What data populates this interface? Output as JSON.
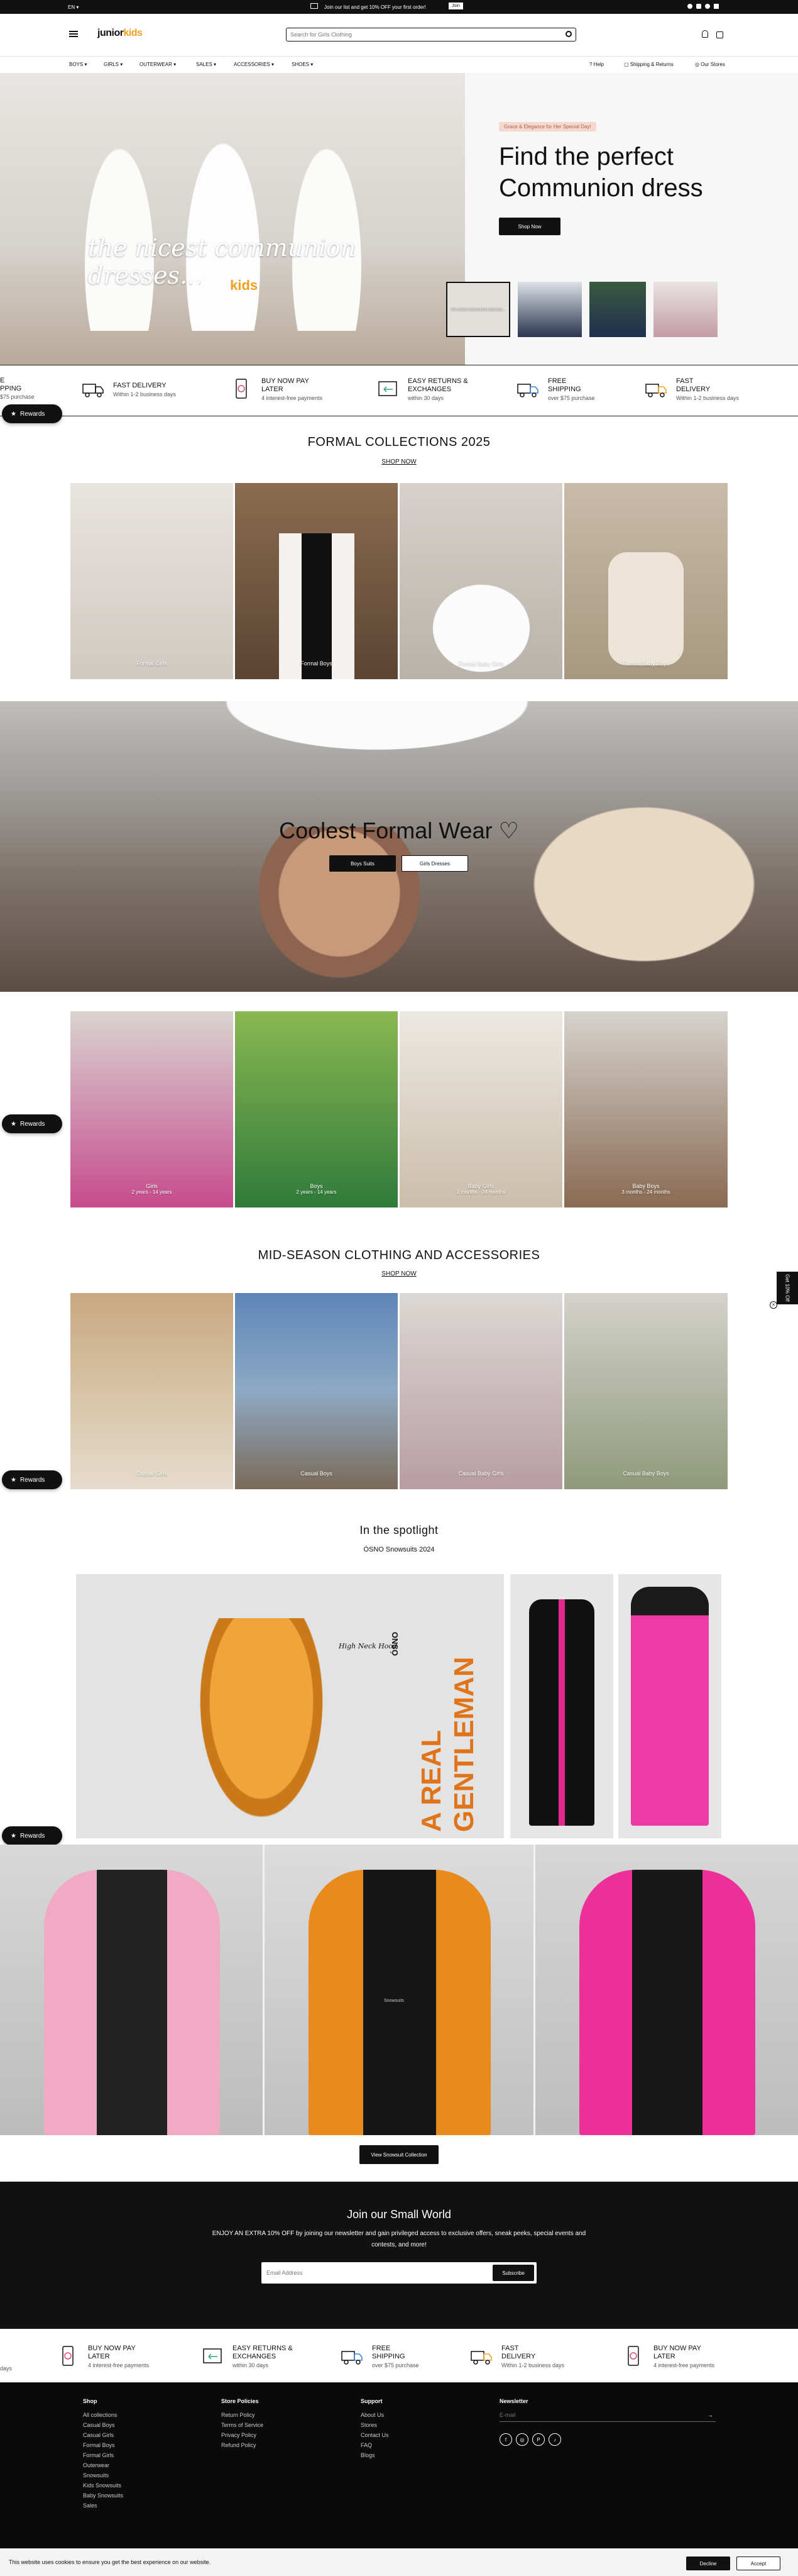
{
  "topbar": {
    "lang": "EN",
    "promo": "Join our list and get 10% OFF your first order!",
    "promo_cta": "Join"
  },
  "header": {
    "logo_a": "junior",
    "logo_b": "kids",
    "search_placeholder": "Search for Girls Clothing"
  },
  "nav": {
    "items": [
      "BOYS",
      "GIRLS",
      "OUTERWEAR",
      "SALES",
      "ACCESSORIES",
      "SHOES"
    ],
    "help": "Help",
    "shipping": "Shipping & Returns",
    "stores": "Our Stores"
  },
  "hero": {
    "script": "the nicest communion dresses...",
    "badge": "Grace & Elegance for Her Special Day!",
    "title_line1": "Find the perfect",
    "title_line2": "Communion dress",
    "cta": "Shop Now",
    "thumb_caption": "the nicest communion dresses..."
  },
  "features": [
    {
      "title": "FAST DELIVERY",
      "sub": "Within 1-2 business days",
      "icon": "truck-icon"
    },
    {
      "title": "BUY NOW PAY LATER",
      "sub": "4 interest-free payments",
      "icon": "phone-payment-icon"
    },
    {
      "title": "EASY RETURNS & EXCHANGES",
      "sub": "within 30 days",
      "icon": "returns-icon"
    },
    {
      "title": "FREE SHIPPING",
      "sub": "over $75 purchase",
      "icon": "shipping-van-icon"
    }
  ],
  "feature_edge": {
    "left_title_1": "E",
    "left_title_2": "PPING",
    "left_sub": "$75 purchase"
  },
  "rewards": {
    "label": "Rewards"
  },
  "formal": {
    "title": "FORMAL COLLECTIONS 2025",
    "link": "SHOP NOW",
    "cards": [
      {
        "label": "Formal Girls",
        "bg": "#d9d4cc"
      },
      {
        "label": "Formal Boys",
        "bg": "#7a6048"
      },
      {
        "label": "Formal Baby Girls",
        "bg": "#c9c2bb"
      },
      {
        "label": "Formal Baby Boys",
        "bg": "#bcae9a"
      }
    ]
  },
  "banner": {
    "title": "Coolest Formal Wear ♡",
    "btn_boys": "Boys Suits",
    "btn_girls": "Girls Dresses"
  },
  "age": {
    "cards": [
      {
        "label": "Girls",
        "sub": "2 years - 14 years",
        "bg": "#c64b8d"
      },
      {
        "label": "Boys",
        "sub": "2 years - 14 years",
        "bg": "#4f8a3d"
      },
      {
        "label": "Baby Girls",
        "sub": "3 months - 24 months",
        "bg": "#d8cfc2"
      },
      {
        "label": "Baby Boys",
        "sub": "3 months - 24 months",
        "bg": "#9a8570"
      }
    ]
  },
  "midseason": {
    "title": "MID-SEASON CLOTHING AND ACCESSORIES",
    "link": "SHOP NOW",
    "cards": [
      {
        "label": "Casual Girls",
        "bg": "#d7c9b3"
      },
      {
        "label": "Casual Boys",
        "bg": "#6f88a8"
      },
      {
        "label": "Casual Baby Girls",
        "bg": "#c9b6b8"
      },
      {
        "label": "Casual Baby Boys",
        "bg": "#a9ab96"
      }
    ]
  },
  "spotlight": {
    "title": "In the spotlight",
    "sub": "ÓSNO Snowsuits 2024",
    "brand": "ÓSNO",
    "vertical": "A REAL GENTLEMAN",
    "handwritten": "High Neck Hood",
    "cta": "View Snowsuit Collection",
    "jacket_text": "Snowsuits"
  },
  "newsletter": {
    "title": "Join our Small World",
    "body": "ENJOY AN EXTRA 10% OFF by joining our newsletter and gain privileged access to exclusive offers, sneak peeks, special events and contests, and more!",
    "placeholder": "Email Address",
    "cta": "Subscribe"
  },
  "features2": [
    {
      "title": "BUY NOW PAY LATER",
      "sub": "4 interest-free payments",
      "icon": "phone-payment-icon"
    },
    {
      "title": "EASY RETURNS & EXCHANGES",
      "sub": "within 30 days",
      "icon": "returns-icon"
    },
    {
      "title": "FREE SHIPPING",
      "sub": "over $75 purchase",
      "icon": "shipping-van-icon"
    },
    {
      "title": "FAST DELIVERY",
      "sub": "Within 1-2 business days",
      "icon": "truck-icon"
    },
    {
      "title": "BUY NOW PAY LATER",
      "sub": "4 interest-free payments",
      "icon": "phone-payment-icon"
    }
  ],
  "features2_edge": "days",
  "footer": {
    "shop": {
      "title": "Shop",
      "items": [
        "All collections",
        "Casual Boys",
        "Casual Girls",
        "Formal Boys",
        "Formal Girls",
        "Outerwear",
        "Snowsuits",
        "Kids Snowsuits",
        "Baby Snowsuits",
        "Sales"
      ]
    },
    "policies": {
      "title": "Store Policies",
      "items": [
        "Return Policy",
        "Terms of Service",
        "Privacy Policy",
        "Refund Policy"
      ]
    },
    "support": {
      "title": "Support",
      "items": [
        "About Us",
        "Stores",
        "Contact Us",
        "FAQ",
        "Blogs"
      ]
    },
    "newsletter": {
      "title": "Newsletter",
      "placeholder": "E-mail"
    }
  },
  "cookie": {
    "text": "This website uses cookies to ensure you get the best experience on our website.",
    "decline": "Decline",
    "accept": "Accept"
  },
  "side_tab": {
    "label": "Get 10% Off"
  },
  "colors": {
    "accent_pink": "#f5d9d0",
    "dark": "#111111"
  }
}
